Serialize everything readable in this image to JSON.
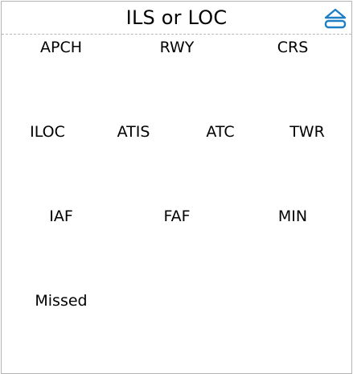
{
  "header": {
    "title": "ILS or LOC",
    "eject_icon": "eject-icon",
    "accent_color": "#1f7fc4"
  },
  "grid": {
    "row1": [
      "APCH",
      "RWY",
      "CRS"
    ],
    "row2": [
      "ILOC",
      "ATIS",
      "ATC",
      "TWR"
    ],
    "row3": [
      "IAF",
      "FAF",
      "MIN"
    ],
    "row4": [
      "Missed"
    ]
  }
}
